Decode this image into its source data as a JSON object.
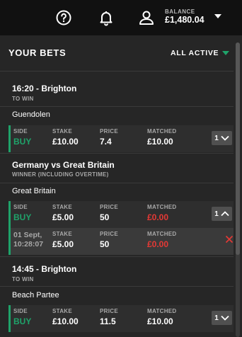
{
  "header": {
    "balance_label": "BALANCE",
    "balance_value": "£1,480.04",
    "icons": [
      "help-icon",
      "bell-icon",
      "user-icon",
      "chevron-down-icon"
    ]
  },
  "panel": {
    "title": "YOUR BETS",
    "filter": "ALL ACTIVE"
  },
  "labels": {
    "side": "SIDE",
    "stake": "STAKE",
    "price": "PRICE",
    "matched": "MATCHED"
  },
  "bets": [
    {
      "event": "16:20 - Brighton",
      "market": "TO WIN",
      "selection": "Guendolen",
      "side": "BUY",
      "stake": "£10.00",
      "price": "7.4",
      "matched": "£10.00",
      "count": "1"
    },
    {
      "event": "Germany vs Great Britain",
      "market": "WINNER (INCLUDING OVERTIME)",
      "selection": "Great Britain",
      "side": "BUY",
      "stake": "£5.00",
      "price": "50",
      "matched": "£0.00",
      "count": "1",
      "sub": {
        "date": "01 Sept,",
        "time": "10:28:07",
        "stake": "£5.00",
        "price": "50",
        "matched": "£0.00"
      }
    },
    {
      "event": "14:45 - Brighton",
      "market": "TO WIN",
      "selection": "Beach Partee",
      "side": "BUY",
      "stake": "£10.00",
      "price": "11.5",
      "matched": "£10.00",
      "count": "1"
    }
  ],
  "colors": {
    "accent": "#1fa36a",
    "danger": "#e53935",
    "panel": "#262626"
  }
}
